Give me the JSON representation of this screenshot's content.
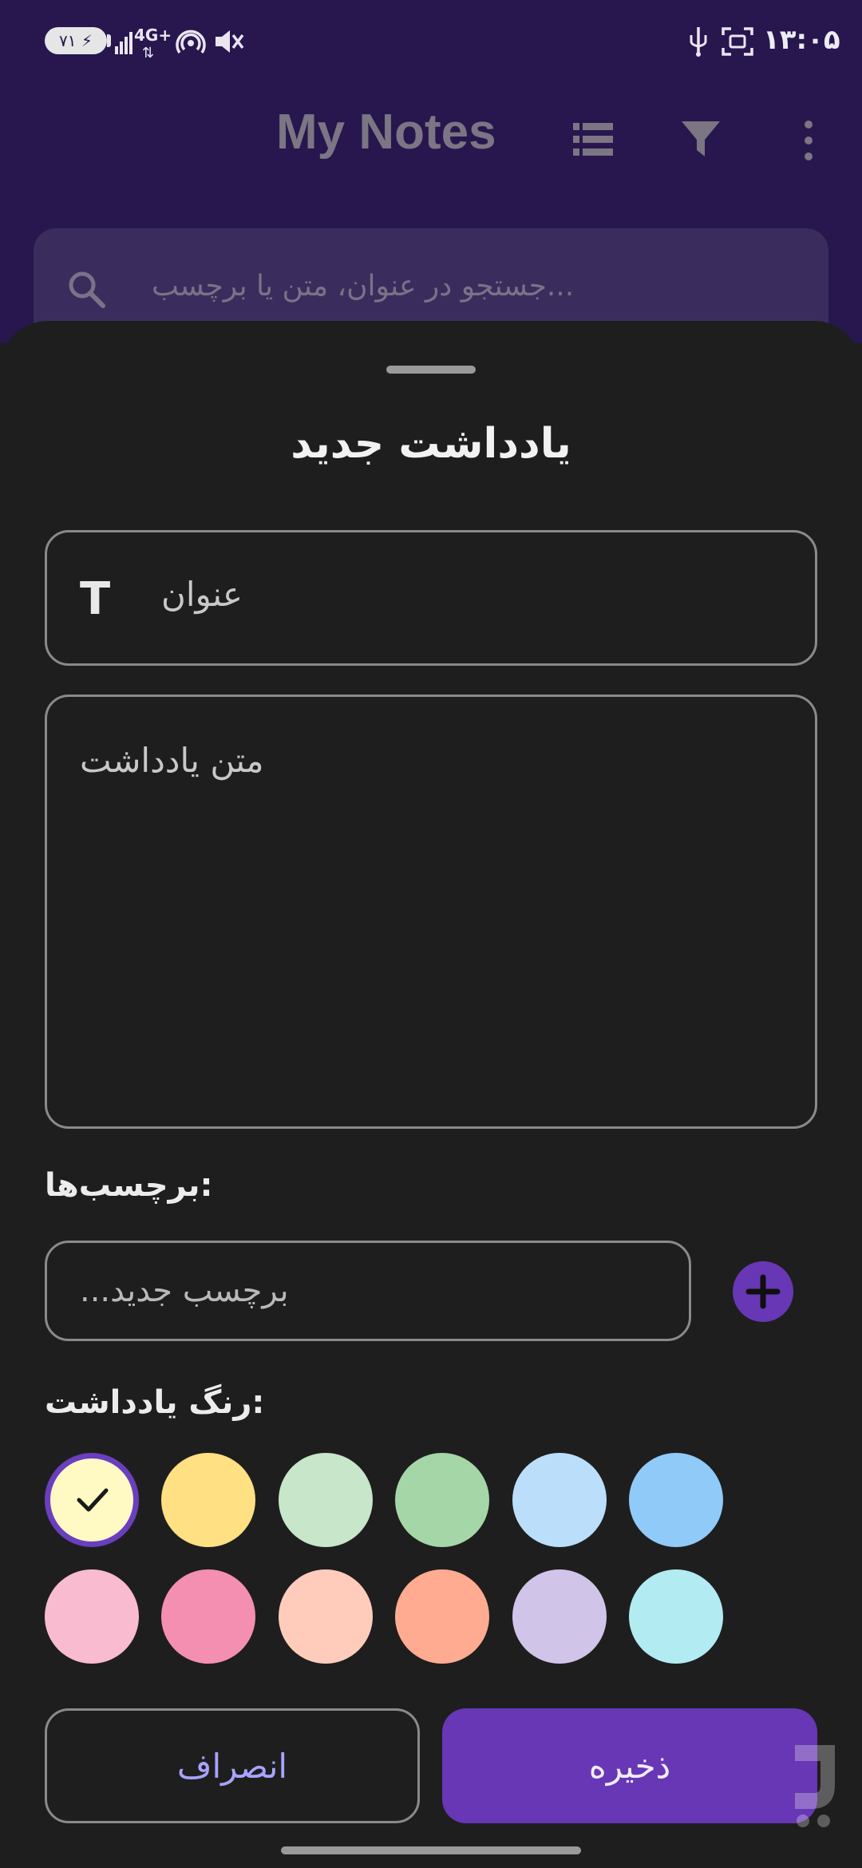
{
  "status_bar": {
    "battery": "۷۱",
    "network": "4G+",
    "time": "۱۳:۰۵"
  },
  "app_bar": {
    "title": "My Notes"
  },
  "search": {
    "placeholder": "...جستجو در عنوان، متن یا برچسب"
  },
  "sheet": {
    "title": "یادداشت جدید",
    "title_placeholder": "عنوان",
    "body_placeholder": "متن یادداشت",
    "tags_label": "برچسب‌ها:",
    "tag_placeholder": "...برچسب جدید",
    "color_label": "رنگ یادداشت:",
    "colors": [
      "#fff9c4",
      "#ffe082",
      "#c8e6c9",
      "#a5d6a7",
      "#bbdefb",
      "#90caf9",
      "#f8bbd0",
      "#f48fb1",
      "#ffccbc",
      "#ffab91",
      "#d1c4e9",
      "#b2ebf2"
    ],
    "selected_color_index": 0,
    "cancel_label": "انصراف",
    "save_label": "ذخیره"
  },
  "theme": {
    "accent": "#6737b5",
    "top_bar": "#27174e",
    "sheet_bg": "#1e1e1e"
  }
}
